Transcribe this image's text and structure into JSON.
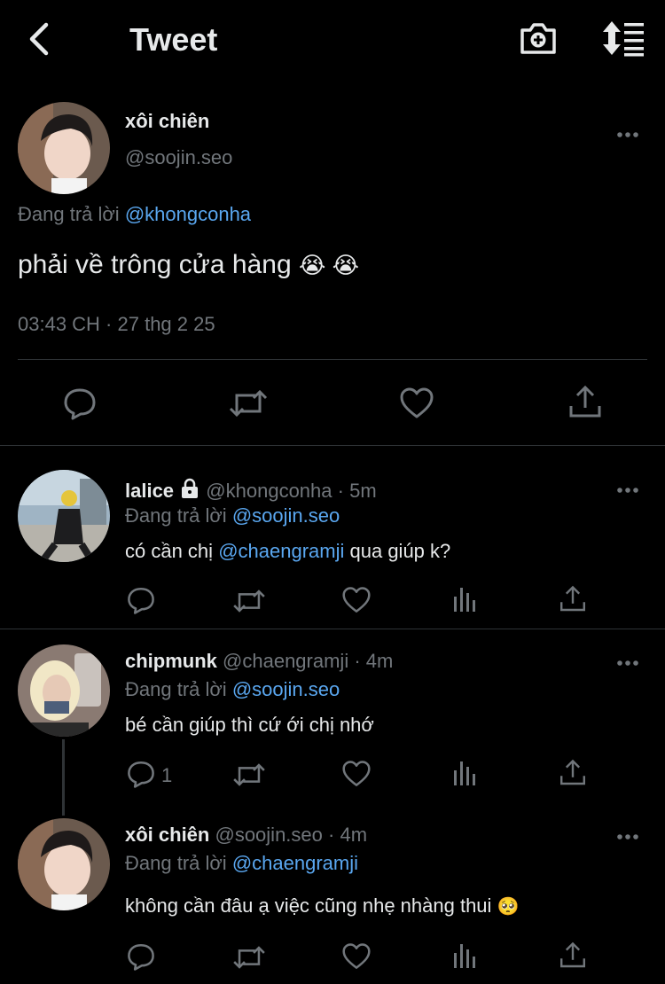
{
  "header": {
    "title": "Tweet",
    "back_icon": "chevron-left-icon",
    "camera_icon": "camera-add-icon",
    "sort_icon": "sort-list-icon"
  },
  "main_tweet": {
    "name": "xôi chiên",
    "handle": "@soojin.seo",
    "replying_prefix": "Đang trả lời",
    "replying_to": "@khongconha",
    "text": "phải về trông cửa hàng",
    "emoji": "😭 😭",
    "timestamp": "03:43 CH · 27 thg 2 25"
  },
  "replies": [
    {
      "name": "lalice",
      "locked": true,
      "handle": "@khongconha",
      "time": "· 5m",
      "replying_prefix": "Đang trả lời",
      "replying_to": "@soojin.seo",
      "text_before": "có cần chị",
      "mention": "@chaengramji",
      "text_after": "qua giúp k?",
      "reply_count": ""
    },
    {
      "name": "chipmunk",
      "handle": "@chaengramji",
      "time": "· 4m",
      "replying_prefix": "Đang trả lời",
      "replying_to": "@soojin.seo",
      "text": "bé cần giúp thì cứ ới chị nhớ",
      "reply_count": "1"
    },
    {
      "name": "xôi chiên",
      "handle": "@soojin.seo",
      "time": "· 4m",
      "replying_prefix": "Đang trả lời",
      "replying_to": "@chaengramji",
      "text": "không cần đâu ạ việc cũng nhẹ nhàng thui",
      "emoji": "🥺",
      "reply_count": ""
    }
  ],
  "colors": {
    "background": "#000000",
    "text": "#e7e9ea",
    "muted": "#71767b",
    "link": "#5aa7f0",
    "divider": "#2f3336"
  }
}
